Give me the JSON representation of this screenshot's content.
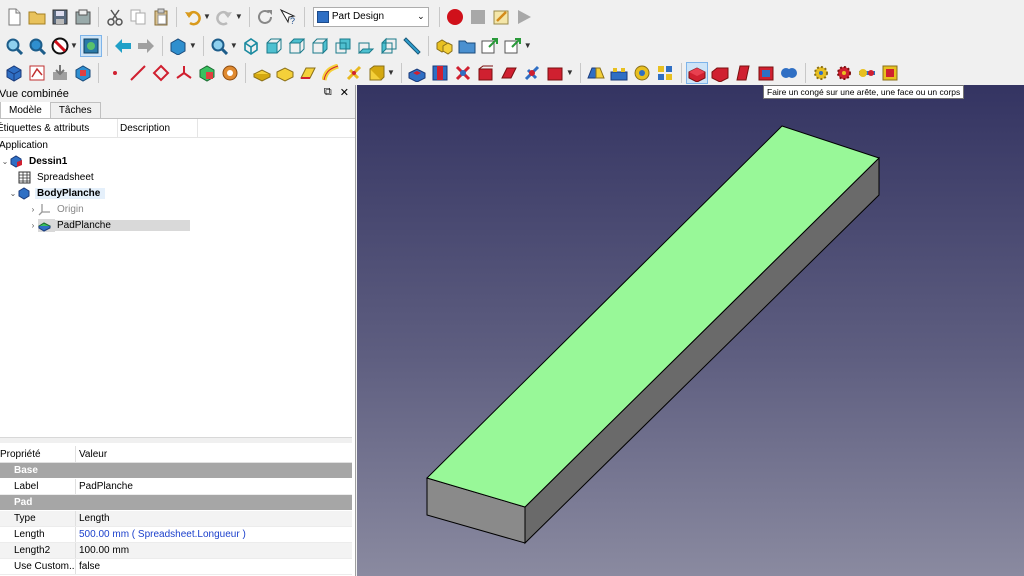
{
  "toolbar": {
    "workbench_selector": "Part Design",
    "row1_icons": [
      "new-document-icon",
      "open-folder-icon",
      "save-icon",
      "save-as-icon",
      "cut-icon",
      "copy-icon",
      "paste-icon",
      "undo-icon",
      "redo-icon",
      "refresh-icon",
      "whats-this-icon"
    ],
    "macro_icons": [
      "record-macro-icon",
      "stop-macro-icon",
      "edit-macro-icon",
      "play-macro-icon"
    ],
    "row2_icons": [
      "fit-all-icon",
      "fit-selection-icon",
      "draw-style-icon",
      "bounding-box-icon",
      "back-icon",
      "forward-icon",
      "stereo-icon",
      "zoom-icon",
      "isometric-icon",
      "front-view-icon",
      "top-view-icon",
      "right-view-icon",
      "rear-view-icon",
      "bottom-view-icon",
      "left-view-icon",
      "measure-icon",
      "part-icon",
      "group-folder-icon",
      "link-icon",
      "link-actions-icon"
    ],
    "row3_icons": [
      "create-body-icon",
      "create-sketch-icon",
      "validate-sketch-icon",
      "shape-binder-icon",
      "datum-point-icon",
      "datum-line-icon",
      "datum-plane-icon",
      "local-cs-icon",
      "sub-shape-binder-icon",
      "clone-icon",
      "pad-icon",
      "revolution-icon",
      "additive-loft-icon",
      "additive-pipe-icon",
      "additive-helix-icon",
      "additive-primitive-icon",
      "pocket-icon",
      "hole-icon",
      "groove-icon",
      "subtractive-loft-icon",
      "subtractive-pipe-icon",
      "subtractive-helix-icon",
      "subtractive-primitive-icon",
      "mirrored-icon",
      "linear-pattern-icon",
      "polar-pattern-icon",
      "multi-transform-icon",
      "fillet-icon",
      "chamfer-icon",
      "draft-icon",
      "thickness-icon",
      "boolean-icon",
      "sprocket-icon",
      "involute-gear-icon",
      "shaft-wizard-icon",
      "import-icon"
    ]
  },
  "combo_view": {
    "title": "Vue combinée",
    "tabs": [
      "Modèle",
      "Tâches"
    ],
    "columns": [
      "Étiquettes & attributs",
      "Description"
    ],
    "section_label": "Application",
    "tree": [
      {
        "label": "Dessin1",
        "icon": "document-icon",
        "depth": 0,
        "expanded": true,
        "bold": true
      },
      {
        "label": "Spreadsheet",
        "icon": "spreadsheet-icon",
        "depth": 1
      },
      {
        "label": "BodyPlanche",
        "icon": "body-icon",
        "depth": 1,
        "expanded": true,
        "bold": true
      },
      {
        "label": "Origin",
        "icon": "origin-icon",
        "depth": 2,
        "collapsed": true,
        "grey": true
      },
      {
        "label": "PadPlanche",
        "icon": "pad-icon",
        "depth": 2,
        "collapsed": true,
        "selected": true
      }
    ]
  },
  "property_view": {
    "columns": [
      "Propriété",
      "Valeur"
    ],
    "groups": [
      {
        "name": "Base",
        "rows": [
          {
            "key": "Label",
            "value": "PadPlanche"
          }
        ]
      },
      {
        "name": "Pad",
        "rows": [
          {
            "key": "Type",
            "value": "Length"
          },
          {
            "key": "Length",
            "value": "500.00 mm  ( Spreadsheet.Longueur )",
            "expression": true
          },
          {
            "key": "Length2",
            "value": "100.00 mm"
          },
          {
            "key": "Use Custom...",
            "value": "false"
          }
        ]
      }
    ]
  },
  "tooltip": "Faire un congé sur une arête, une face ou un corps",
  "viewport": {
    "background_top": "#343462",
    "background_bottom": "#8a8aa0",
    "top_face_color": "#98f898",
    "side_face_color": "#808080"
  }
}
